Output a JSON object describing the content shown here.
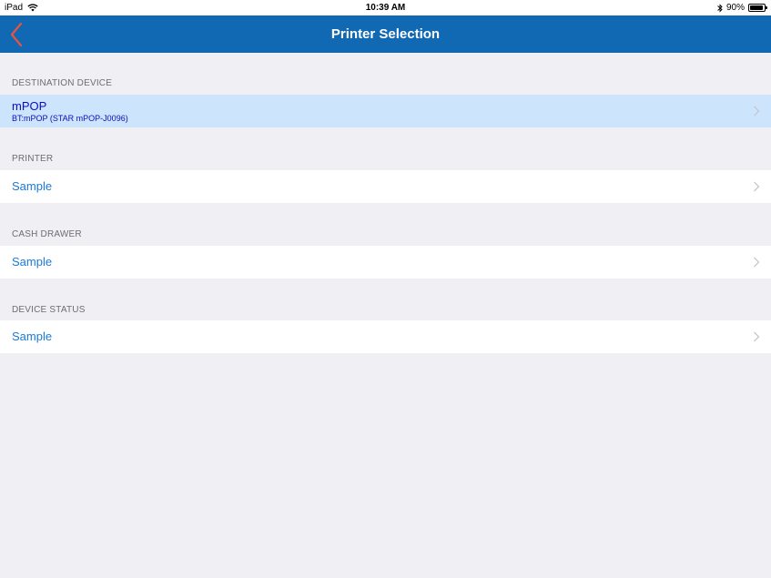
{
  "status_bar": {
    "device": "iPad",
    "time": "10:39 AM",
    "battery": "90%",
    "battery_level": 0.9,
    "icons": [
      "wifi-icon",
      "bluetooth-icon",
      "battery-icon"
    ]
  },
  "nav": {
    "title": "Printer Selection",
    "back_icon": "chevron-left-icon",
    "accent_color": "#e8553f",
    "bar_color": "#1168b3"
  },
  "sections": {
    "destination": {
      "header": "DESTINATION DEVICE",
      "title": "mPOP",
      "subtitle": "BT:mPOP (STAR mPOP-J0096)"
    },
    "printer": {
      "header": "PRINTER",
      "value": "Sample"
    },
    "cash_drawer": {
      "header": "CASH DRAWER",
      "value": "Sample"
    },
    "device_status": {
      "header": "DEVICE STATUS",
      "value": "Sample"
    }
  }
}
